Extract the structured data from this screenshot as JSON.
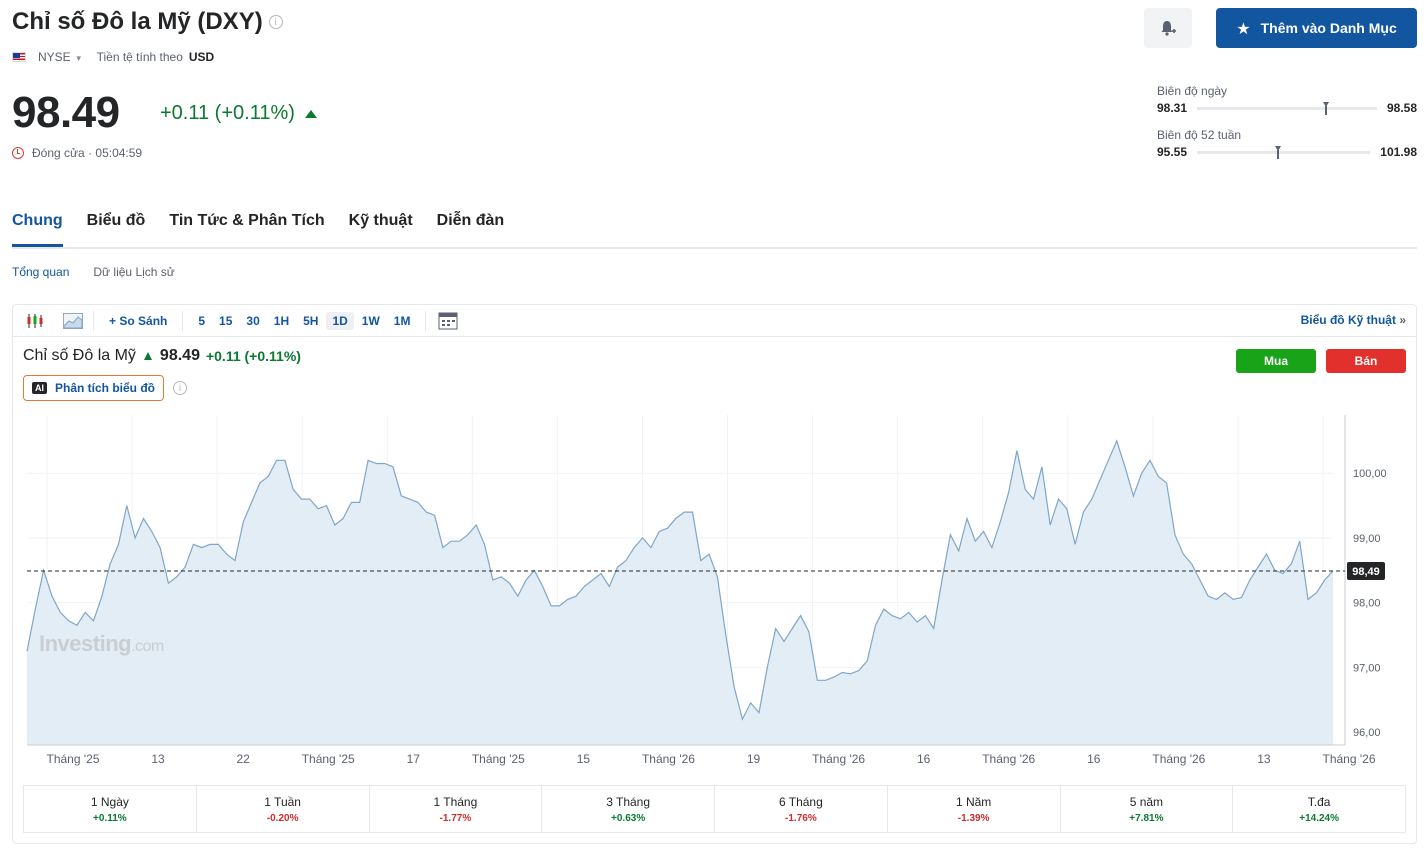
{
  "header": {
    "title": "Chỉ số Đô la Mỹ (DXY)",
    "exchange": "NYSE",
    "currency_label": "Tiền tệ tính theo",
    "currency": "USD",
    "watchlist_button": "Thêm vào Danh Mục",
    "accent_color": "#1256a0"
  },
  "quote": {
    "price": "98.49",
    "change": "+0.11 (+0.11%)",
    "direction": "up",
    "status": "Đóng cửa · 05:04:59"
  },
  "ranges": {
    "day": {
      "label": "Biên độ ngày",
      "low": "98.31",
      "high": "98.58",
      "position": 0.7
    },
    "week52": {
      "label": "Biên độ 52 tuần",
      "low": "95.55",
      "high": "101.98",
      "position": 0.45
    }
  },
  "tabs": [
    "Chung",
    "Biểu đồ",
    "Tin Tức & Phân Tích",
    "Kỹ thuật",
    "Diễn đàn"
  ],
  "subtabs": [
    "Tổng quan",
    "Dữ liệu Lịch sử"
  ],
  "toolbar": {
    "compare": "So Sánh",
    "intervals": [
      "5",
      "15",
      "30",
      "1H",
      "5H",
      "1D",
      "1W",
      "1M"
    ],
    "active_interval": "1D",
    "tech_chart_link": "Biểu đồ Kỹ thuật"
  },
  "legend": {
    "name": "Chỉ số Đô la Mỹ",
    "value": "98.49",
    "change": "+0.11 (+0.11%)"
  },
  "ai_button": "Phân tích biểu đồ",
  "buy_label": "Mua",
  "sell_label": "Bán",
  "watermark": {
    "main": "Investing",
    "suffix": ".com"
  },
  "chart_data": {
    "type": "area",
    "last_value": 98.49,
    "last_label": "98,49",
    "y_ticks": [
      "100,00",
      "99,00",
      "98,00",
      "97,00",
      "96,00"
    ],
    "y_tick_values": [
      100,
      99,
      98,
      97,
      96
    ],
    "ylim": [
      95.8,
      100.9
    ],
    "x_tick_labels": [
      "Tháng '25",
      "13",
      "22",
      "Tháng '25",
      "17",
      "Tháng '25",
      "15",
      "Tháng '26",
      "19",
      "Tháng '26",
      "16",
      "Tháng '26",
      "16",
      "Tháng '26",
      "13",
      "Tháng '26"
    ],
    "values": [
      97.25,
      97.9,
      98.5,
      98.1,
      97.85,
      97.72,
      97.65,
      97.85,
      97.72,
      98.1,
      98.6,
      98.9,
      99.5,
      99.0,
      99.3,
      99.1,
      98.85,
      98.3,
      98.4,
      98.55,
      98.9,
      98.85,
      98.9,
      98.9,
      98.75,
      98.65,
      99.25,
      99.55,
      99.85,
      99.95,
      100.2,
      100.2,
      99.75,
      99.6,
      99.6,
      99.45,
      99.5,
      99.2,
      99.3,
      99.55,
      99.55,
      100.2,
      100.15,
      100.15,
      100.1,
      99.65,
      99.6,
      99.55,
      99.4,
      99.35,
      98.85,
      98.95,
      98.95,
      99.05,
      99.2,
      98.9,
      98.35,
      98.4,
      98.3,
      98.1,
      98.35,
      98.5,
      98.25,
      97.95,
      97.95,
      98.05,
      98.1,
      98.25,
      98.35,
      98.45,
      98.25,
      98.55,
      98.65,
      98.85,
      99.0,
      98.85,
      99.1,
      99.15,
      99.3,
      99.4,
      99.4,
      98.65,
      98.75,
      98.4,
      97.5,
      96.7,
      96.2,
      96.45,
      96.3,
      97.0,
      97.6,
      97.4,
      97.6,
      97.8,
      97.55,
      96.8,
      96.8,
      96.85,
      96.92,
      96.9,
      96.95,
      97.1,
      97.65,
      97.9,
      97.8,
      97.75,
      97.85,
      97.7,
      97.8,
      97.6,
      98.35,
      99.05,
      98.8,
      99.3,
      98.95,
      99.1,
      98.85,
      99.25,
      99.7,
      100.35,
      99.75,
      99.6,
      100.1,
      99.2,
      99.6,
      99.45,
      98.9,
      99.4,
      99.6,
      99.9,
      100.2,
      100.5,
      100.1,
      99.65,
      100.0,
      100.2,
      99.95,
      99.85,
      99.05,
      98.75,
      98.6,
      98.35,
      98.1,
      98.05,
      98.15,
      98.05,
      98.08,
      98.35,
      98.55,
      98.75,
      98.5,
      98.45,
      98.6,
      98.95,
      98.05,
      98.15,
      98.35,
      98.49
    ]
  },
  "performance": [
    {
      "label": "1 Ngày",
      "value": "+0.11%",
      "dir": "pos"
    },
    {
      "label": "1 Tuần",
      "value": "-0.20%",
      "dir": "neg"
    },
    {
      "label": "1 Tháng",
      "value": "-1.77%",
      "dir": "neg"
    },
    {
      "label": "3 Tháng",
      "value": "+0.63%",
      "dir": "pos"
    },
    {
      "label": "6 Tháng",
      "value": "-1.76%",
      "dir": "neg"
    },
    {
      "label": "1 Năm",
      "value": "-1.39%",
      "dir": "neg"
    },
    {
      "label": "5 năm",
      "value": "+7.81%",
      "dir": "pos"
    },
    {
      "label": "T.đa",
      "value": "+14.24%",
      "dir": "pos"
    }
  ]
}
